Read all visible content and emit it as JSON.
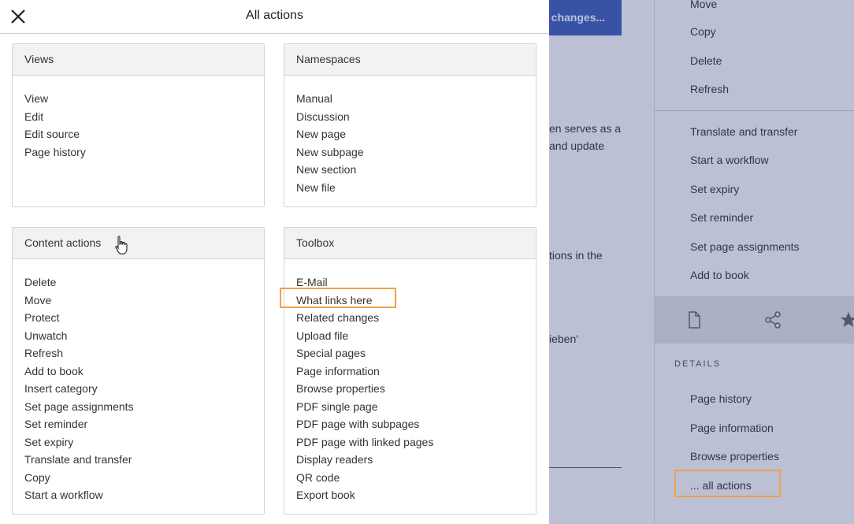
{
  "dialog": {
    "title": "All actions",
    "sections": [
      {
        "title": "Views",
        "items": [
          "View",
          "Edit",
          "Edit source",
          "Page history"
        ]
      },
      {
        "title": "Namespaces",
        "items": [
          "Manual",
          "Discussion",
          "New page",
          "New subpage",
          "New section",
          "New file"
        ]
      },
      {
        "title": "Content actions",
        "items": [
          "Delete",
          "Move",
          "Protect",
          "Unwatch",
          "Refresh",
          "Add to book",
          "Insert category",
          "Set page assignments",
          "Set reminder",
          "Set expiry",
          "Translate and transfer",
          "Copy",
          "Start a workflow"
        ]
      },
      {
        "title": "Toolbox",
        "items": [
          "E-Mail",
          "What links here",
          "Related changes",
          "Upload file",
          "Special pages",
          "Page information",
          "Browse properties",
          "PDF single page",
          "PDF page with subpages",
          "PDF page with linked pages",
          "Display readers",
          "QR code",
          "Export book"
        ]
      }
    ]
  },
  "background": {
    "save_button": "e changes...",
    "text_1": "en serves as a",
    "text_2": "and update",
    "text_3_highlight": "tions",
    "text_3_rest": " in the",
    "text_4": "ieben'"
  },
  "right_panel": {
    "group1": [
      "Move",
      "Copy",
      "Delete",
      "Refresh"
    ],
    "group2": [
      "Translate and transfer",
      "Start a workflow",
      "Set expiry",
      "Set reminder",
      "Set page assignments",
      "Add to book"
    ],
    "details_heading": "DETAILS",
    "details": [
      "Page history",
      "Page information",
      "Browse properties",
      "... all actions"
    ]
  },
  "colors": {
    "highlight_border": "#f0a04b",
    "overlay": "#2d3c78",
    "save_button": "#3e5dbc"
  }
}
